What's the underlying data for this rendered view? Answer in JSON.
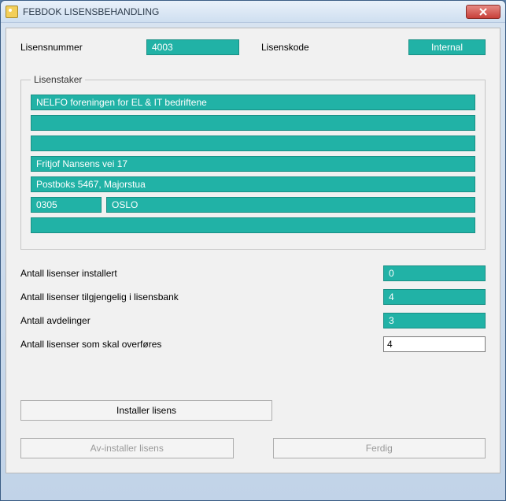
{
  "window": {
    "title": "FEBDOK LISENSBEHANDLING"
  },
  "top": {
    "lisensnummer_label": "Lisensnummer",
    "lisensnummer_value": "4003",
    "lisenskode_label": "Lisenskode",
    "internal_button": "Internal"
  },
  "group": {
    "legend": "Lisenstaker",
    "line1": "NELFO foreningen for EL & IT bedriftene",
    "line2": "",
    "line3": "",
    "street": "Fritjof Nansens vei 17",
    "postbox": "Postboks 5467, Majorstua",
    "zip": "0305",
    "city": "OSLO",
    "line_last": ""
  },
  "stats": {
    "installed_label": "Antall lisenser installert",
    "installed_value": "0",
    "available_label": "Antall lisenser tilgjengelig i lisensbank",
    "available_value": "4",
    "departments_label": "Antall avdelinger",
    "departments_value": "3",
    "transfer_label": "Antall lisenser som skal overføres",
    "transfer_value": "4"
  },
  "buttons": {
    "install": "Installer lisens",
    "uninstall": "Av-installer lisens",
    "done": "Ferdig"
  }
}
